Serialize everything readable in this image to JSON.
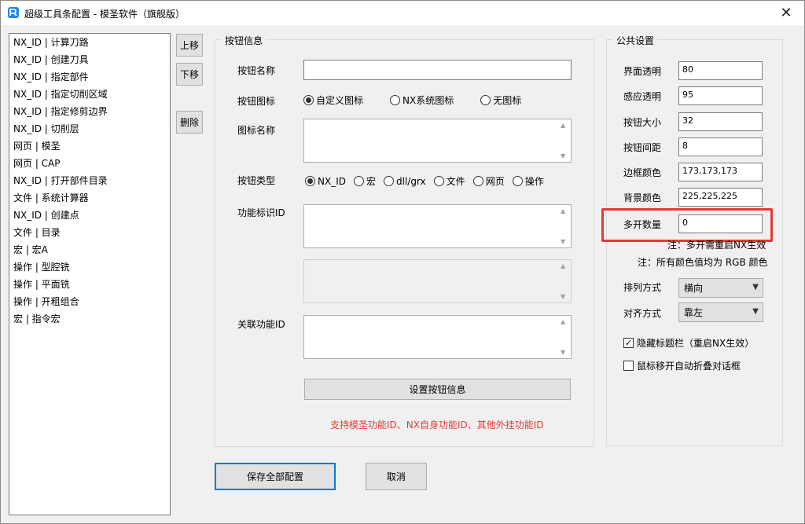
{
  "window": {
    "title": "超级工具条配置 - 模圣软件（旗舰版）",
    "close_label": "✕"
  },
  "button_list": {
    "items": [
      "NX_ID | 计算刀路",
      "NX_ID | 创建刀具",
      "NX_ID | 指定部件",
      "NX_ID | 指定切削区域",
      "NX_ID | 指定修剪边界",
      "NX_ID | 切削层",
      "网页 | 模圣",
      "网页 | CAP",
      "NX_ID | 打开部件目录",
      "文件 | 系统计算器",
      "NX_ID | 创建点",
      "文件 | 目录",
      "宏 | 宏A",
      "操作 | 型腔铣",
      "操作 | 平面铣",
      "操作 | 开粗组合",
      "宏 | 指令宏"
    ]
  },
  "side_buttons": {
    "move_up": "上移",
    "move_down": "下移",
    "delete": "删除"
  },
  "button_info": {
    "group_title": "按钮信息",
    "name_label": "按钮名称",
    "name_value": "",
    "icon_label": "按钮图标",
    "icon_options": [
      "自定义图标",
      "NX系统图标",
      "无图标"
    ],
    "icon_selected": 0,
    "icon_name_label": "图标名称",
    "type_label": "按钮类型",
    "type_options": [
      "NX_ID",
      "宏",
      "dll/grx",
      "文件",
      "网页",
      "操作"
    ],
    "type_selected": 0,
    "function_id_label": "功能标识ID",
    "related_id_label": "关联功能ID",
    "set_button": "设置按钮信息",
    "support_note": "支持模圣功能ID、NX自身功能ID、其他外挂功能ID"
  },
  "footer": {
    "save_all": "保存全部配置",
    "cancel": "取消"
  },
  "public_settings": {
    "group_title": "公共设置",
    "fields": [
      {
        "label": "界面透明",
        "value": "80"
      },
      {
        "label": "感应透明",
        "value": "95"
      },
      {
        "label": "按钮大小",
        "value": "32"
      },
      {
        "label": "按钮间距",
        "value": "8"
      },
      {
        "label": "边框颜色",
        "value": "173,173,173"
      },
      {
        "label": "背景颜色",
        "value": "225,225,225"
      },
      {
        "label": "多开数量",
        "value": "0"
      }
    ],
    "note_restart": "注：多开需重启NX生效",
    "note_color": "注：所有颜色值均为 RGB 颜色",
    "arrange_label": "排列方式",
    "arrange_value": "横向",
    "align_label": "对齐方式",
    "align_value": "靠左",
    "hide_titlebar_label": "隐藏标题栏（重启NX生效）",
    "hide_titlebar_checked": true,
    "auto_fold_label": "鼠标移开自动折叠对话框",
    "auto_fold_checked": false
  },
  "colors": {
    "highlight": "#e53935",
    "accent": "#0078d7",
    "logo_blue": "#1e88e5"
  }
}
